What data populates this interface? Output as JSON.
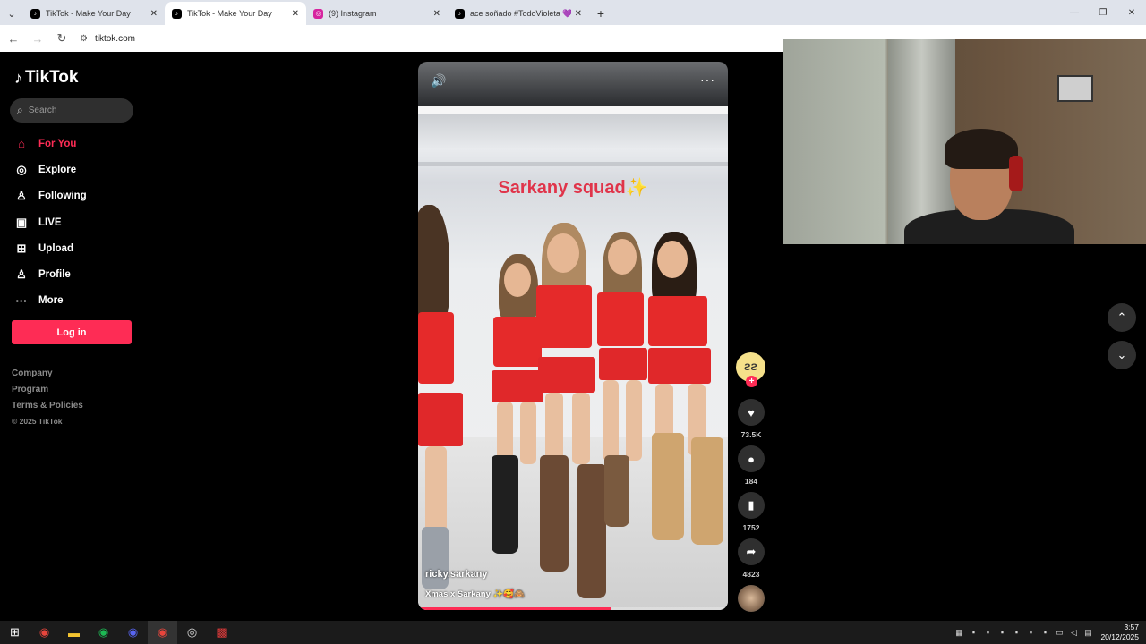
{
  "browser": {
    "tabs": [
      {
        "title": "TikTok - Make Your Day",
        "favicon": "tiktok-icon",
        "active": false
      },
      {
        "title": "TikTok - Make Your Day",
        "favicon": "tiktok-icon",
        "active": true
      },
      {
        "title": "(9) Instagram",
        "favicon": "instagram-icon",
        "active": false
      },
      {
        "title": "ace soñado #TodoVioleta 💜 ®",
        "favicon": "tiktok-icon",
        "active": false
      }
    ],
    "url": "tiktok.com"
  },
  "sidebar": {
    "logo": "TikTok",
    "search_placeholder": "Search",
    "nav": [
      {
        "label": "For You",
        "icon": "home-icon",
        "active": true
      },
      {
        "label": "Explore",
        "icon": "compass-icon",
        "active": false
      },
      {
        "label": "Following",
        "icon": "user-follow-icon",
        "active": false
      },
      {
        "label": "LIVE",
        "icon": "live-icon",
        "active": false
      },
      {
        "label": "Upload",
        "icon": "upload-icon",
        "active": false
      },
      {
        "label": "Profile",
        "icon": "profile-icon",
        "active": false
      },
      {
        "label": "More",
        "icon": "more-icon",
        "active": false
      }
    ],
    "login_label": "Log in",
    "footer": [
      "Company",
      "Program",
      "Terms & Policies"
    ],
    "copyright": "© 2025 TikTok"
  },
  "video": {
    "overlay_text": "Sarkany squad✨",
    "author": "ricky.sarkany",
    "description": "Xmas x Sarkany ✨🥰🙈",
    "progress": 0.62
  },
  "actions": {
    "likes": "73.5K",
    "comments": "184",
    "saves": "1752",
    "shares": "4823"
  },
  "taskbar": {
    "time": "3:57",
    "date": "20/12/2025"
  },
  "colors": {
    "accent": "#fe2c55",
    "background": "#000000",
    "panel": "#2f2f2f"
  }
}
